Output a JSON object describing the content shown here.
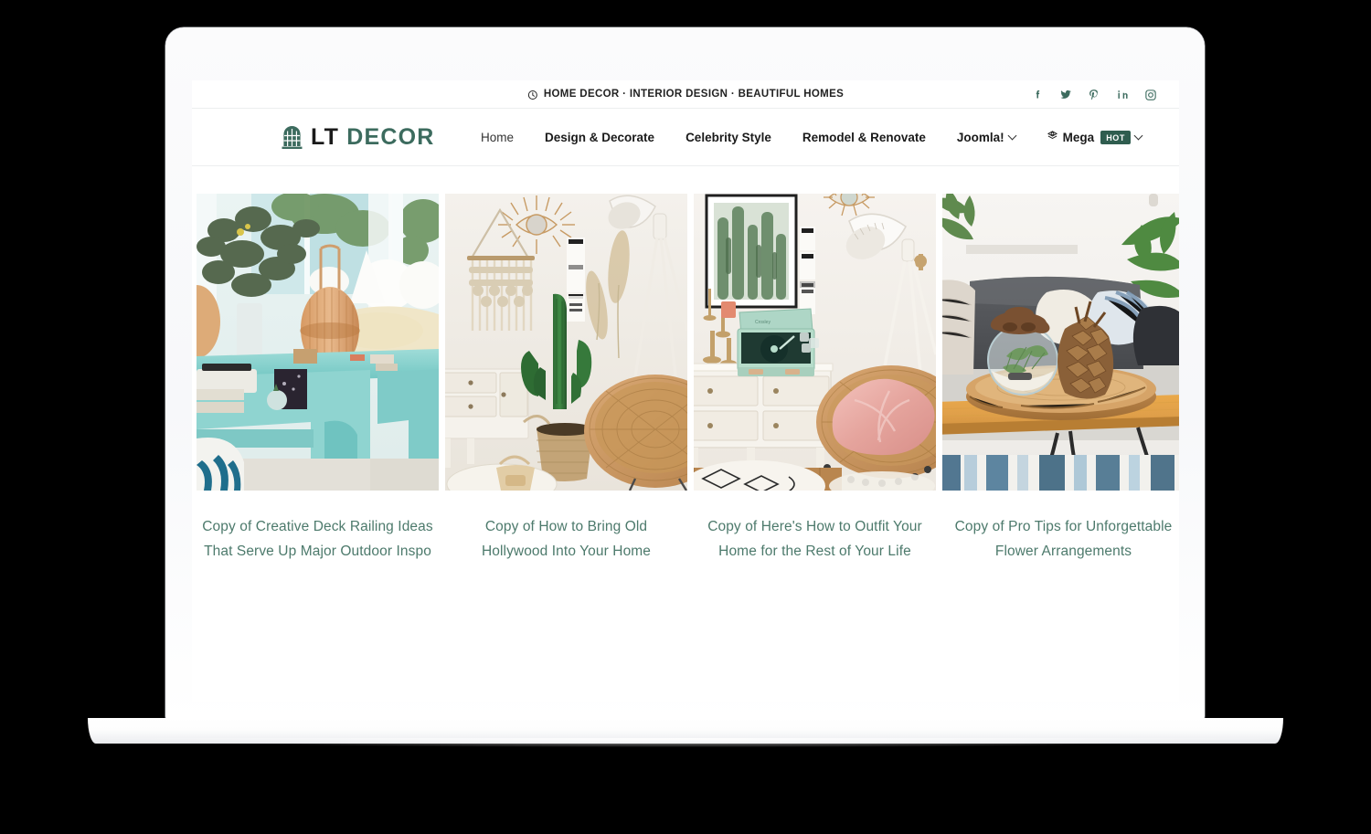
{
  "topbar": {
    "clock_icon": "clock-icon",
    "tagline": "HOME DECOR · INTERIOR DESIGN · BEAUTIFUL HOMES",
    "socials": [
      {
        "name": "facebook-icon",
        "label": "f"
      },
      {
        "name": "twitter-icon",
        "label": "t"
      },
      {
        "name": "pinterest-icon",
        "label": "p"
      },
      {
        "name": "linkedin-icon",
        "label": "in"
      },
      {
        "name": "instagram-icon",
        "label": "ig"
      }
    ]
  },
  "brand": {
    "mark_icon": "arched-window-logo-icon",
    "name_primary": "LT",
    "name_secondary": "DECOR",
    "primary_color": "#1a1a1a",
    "accent_color": "#3c6b5e"
  },
  "nav": {
    "items": [
      {
        "label": "Home",
        "weight": "regular",
        "has_chevron": false,
        "badge": null,
        "icon": null
      },
      {
        "label": "Design & Decorate",
        "weight": "bold",
        "has_chevron": false,
        "badge": null,
        "icon": null
      },
      {
        "label": "Celebrity Style",
        "weight": "bold",
        "has_chevron": false,
        "badge": null,
        "icon": null
      },
      {
        "label": "Remodel & Renovate",
        "weight": "bold",
        "has_chevron": false,
        "badge": null,
        "icon": null
      },
      {
        "label": "Joomla!",
        "weight": "bold",
        "has_chevron": true,
        "badge": null,
        "icon": null
      },
      {
        "label": "Mega",
        "weight": "bold",
        "has_chevron": true,
        "badge": "HOT",
        "icon": "mega-menu-icon"
      }
    ],
    "badge_bg": "#2f5d4f",
    "badge_color": "#ffffff"
  },
  "articles": [
    {
      "title": "Copy of Creative Deck Railing Ideas That Serve Up Major Outdoor Inspo",
      "image_name": "living-room-turquoise-console-rattan-lantern"
    },
    {
      "title": "Copy of How to Bring Old Hollywood Into Your Home",
      "image_name": "boho-room-macrame-cactus-rattan-chair"
    },
    {
      "title": "Copy of Here's How to Outfit Your Home for the Rest of Your Life",
      "image_name": "white-dresser-mint-record-player-pink-cushion"
    },
    {
      "title": "Copy of Pro Tips for Unforgettable Flower Arrangements",
      "image_name": "wood-slab-coffee-table-pinecones-terrarium"
    }
  ],
  "theme": {
    "title_color": "#4d7a6c",
    "page_background": "#ffffff",
    "canvas_background": "#000000"
  }
}
